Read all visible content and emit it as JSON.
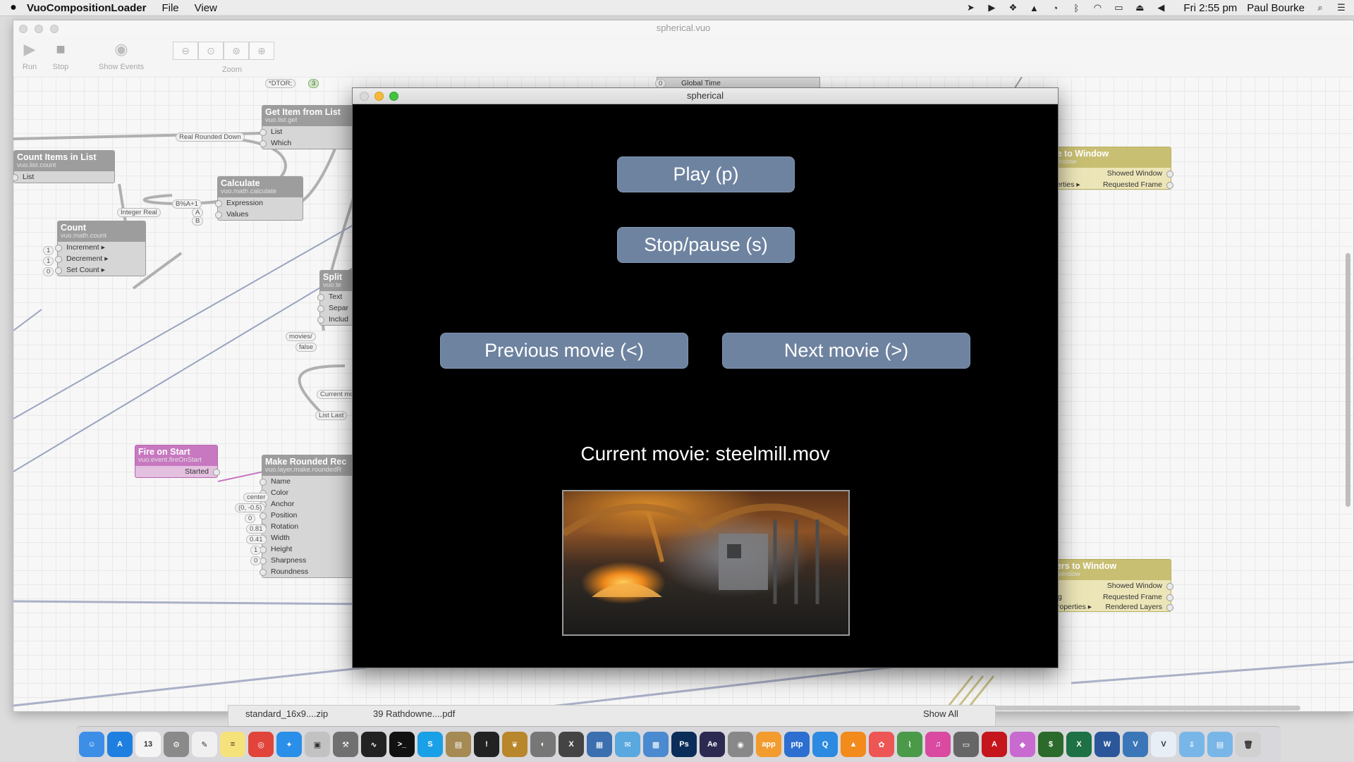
{
  "menubar": {
    "app_name": "VuoCompositionLoader",
    "menus": [
      "File",
      "View"
    ],
    "clock": "Fri 2:55 pm",
    "user": "Paul Bourke"
  },
  "editor": {
    "title": "spherical.vuo",
    "toolbar": {
      "run": "Run",
      "stop": "Stop",
      "show_events": "Show Events",
      "zoom": "Zoom"
    },
    "nodes": {
      "get_item": {
        "title": "Get Item from List",
        "subtitle": "vuo.list.get",
        "ports": [
          "List",
          "Which"
        ]
      },
      "count_items": {
        "title": "Count Items in List",
        "subtitle": "vuo.list.count",
        "ports": [
          "List"
        ]
      },
      "calculate": {
        "title": "Calculate",
        "subtitle": "vuo.math.calculate",
        "ports": [
          "Expression",
          "Values"
        ]
      },
      "count": {
        "title": "Count",
        "subtitle": "vuo.math.count",
        "ports": [
          "Increment ▸",
          "Decrement ▸",
          "Set Count ▸"
        ]
      },
      "split": {
        "title": "Split",
        "subtitle": "vuo.te",
        "ports": [
          "Text",
          "Separ",
          "Includ"
        ]
      },
      "fire_on_start": {
        "title": "Fire on Start",
        "subtitle": "vuo.event.fireOnStart",
        "outputs": [
          "Started"
        ]
      },
      "make_rounded": {
        "title": "Make Rounded Rec",
        "subtitle": "vuo.layer.make.roundedR",
        "ports": [
          "Name",
          "Color",
          "Anchor",
          "Position",
          "Rotation",
          "Width",
          "Height",
          "Sharpness",
          "Roundness"
        ]
      },
      "render_image": {
        "title": "age to Window",
        "subtitle": "er.window",
        "ports": [
          "perties ▸"
        ],
        "outputs": [
          "Showed Window",
          "Requested Frame"
        ]
      },
      "render_layers": {
        "title": "ayers to Window",
        "subtitle": "der.window",
        "ports": [
          "ing",
          "Properties ▸"
        ],
        "outputs": [
          "Showed Window",
          "Requested Frame",
          "Rendered Layers"
        ]
      },
      "global_time": {
        "label": "Global Time",
        "value": "0"
      }
    },
    "constants": {
      "dtor": "*DTOR;",
      "dtor_val": "3",
      "real_rounded": "Real     Rounded Down",
      "integer_real": "Integer     Real",
      "expr": "B%A+1",
      "a": "A",
      "b": "B",
      "inc": "1",
      "dec": "1",
      "set": "0",
      "movies": "movies/",
      "false": "false",
      "current_mo": "Current mo",
      "list_last": "List    Last",
      "anchor": "center",
      "position": "(0, -0.5)",
      "rotation": "0",
      "width": "0.81",
      "height": "0.41",
      "sharpness": "1",
      "roundness": "0"
    }
  },
  "viewer": {
    "title": "spherical",
    "buttons": {
      "play": "Play (p)",
      "stop": "Stop/pause (s)",
      "prev": "Previous movie (<)",
      "next": "Next movie (>)"
    },
    "current_movie": "Current movie: steelmill.mov"
  },
  "downloads": {
    "item1": "standard_16x9....zip",
    "item2": "39 Rathdowne....pdf",
    "show_all": "Show All"
  },
  "dock": {
    "apps": [
      {
        "name": "finder-icon",
        "color": "#3c8ee6",
        "glyph": "☺"
      },
      {
        "name": "app-store-icon",
        "color": "#1f7fe0",
        "glyph": "A"
      },
      {
        "name": "calendar-icon",
        "color": "#f4f4f4",
        "glyph": "13"
      },
      {
        "name": "system-preferences-icon",
        "color": "#8a8a8a",
        "glyph": "⚙"
      },
      {
        "name": "textedit-icon",
        "color": "#f0f0f0",
        "glyph": "✎"
      },
      {
        "name": "notes-icon",
        "color": "#f6e27a",
        "glyph": "≡"
      },
      {
        "name": "chrome-icon",
        "color": "#e0443a",
        "glyph": "◎"
      },
      {
        "name": "safari-icon",
        "color": "#2a8fe8",
        "glyph": "✦"
      },
      {
        "name": "preview-icon",
        "color": "#c2c2c2",
        "glyph": "▣"
      },
      {
        "name": "utility-icon",
        "color": "#707070",
        "glyph": "⚒"
      },
      {
        "name": "activity-monitor-icon",
        "color": "#222",
        "glyph": "∿"
      },
      {
        "name": "terminal-icon",
        "color": "#111",
        "glyph": ">_"
      },
      {
        "name": "skype-icon",
        "color": "#1aa0e6",
        "glyph": "S"
      },
      {
        "name": "notebook-icon",
        "color": "#a58a54",
        "glyph": "▤"
      },
      {
        "name": "console-icon",
        "color": "#222",
        "glyph": "!"
      },
      {
        "name": "rosetta-icon",
        "color": "#b8862b",
        "glyph": "❦"
      },
      {
        "name": "network-icon",
        "color": "#777",
        "glyph": "◐"
      },
      {
        "name": "x11-icon",
        "color": "#444",
        "glyph": "X"
      },
      {
        "name": "photo-icon",
        "color": "#3b6fb0",
        "glyph": "▦"
      },
      {
        "name": "migration-icon",
        "color": "#5aa8e0",
        "glyph": "✉"
      },
      {
        "name": "image-capture-icon",
        "color": "#4a8ad0",
        "glyph": "▩"
      },
      {
        "name": "photoshop-icon",
        "color": "#0b2d5a",
        "glyph": "Ps"
      },
      {
        "name": "after-effects-icon",
        "color": "#2d2a52",
        "glyph": "Ae"
      },
      {
        "name": "eye-icon",
        "color": "#888",
        "glyph": "◉"
      },
      {
        "name": "app-icon",
        "color": "#f29b2e",
        "glyph": "app"
      },
      {
        "name": "ptp-icon",
        "color": "#2d6fd0",
        "glyph": "ptp"
      },
      {
        "name": "quicktime-icon",
        "color": "#2c8ae0",
        "glyph": "Q"
      },
      {
        "name": "vlc-icon",
        "color": "#f28a1c",
        "glyph": "▲"
      },
      {
        "name": "photos-icon",
        "color": "#e55",
        "glyph": "✿"
      },
      {
        "name": "grapher-icon",
        "color": "#4a9a4a",
        "glyph": "⌇"
      },
      {
        "name": "itunes-icon",
        "color": "#d94aa0",
        "glyph": "♫"
      },
      {
        "name": "scanner-icon",
        "color": "#666",
        "glyph": "▭"
      },
      {
        "name": "acrobat-icon",
        "color": "#c4161c",
        "glyph": "A"
      },
      {
        "name": "colorsync-icon",
        "color": "#c86ad0",
        "glyph": "◆"
      },
      {
        "name": "cli-icon",
        "color": "#2c6a2c",
        "glyph": "$"
      },
      {
        "name": "excel-icon",
        "color": "#1e7145",
        "glyph": "X"
      },
      {
        "name": "word-icon",
        "color": "#2b579a",
        "glyph": "W"
      },
      {
        "name": "vuo-icon",
        "color": "#3b77b8",
        "glyph": "V"
      },
      {
        "name": "vuo-doc-icon",
        "color": "#e8eef6",
        "glyph": "V"
      },
      {
        "name": "downloads-folder-icon",
        "color": "#78b6e8",
        "glyph": "⇩"
      },
      {
        "name": "documents-folder-icon",
        "color": "#78b6e8",
        "glyph": "▤"
      },
      {
        "name": "trash-icon",
        "color": "#d0d0d0",
        "glyph": "🗑"
      }
    ]
  }
}
